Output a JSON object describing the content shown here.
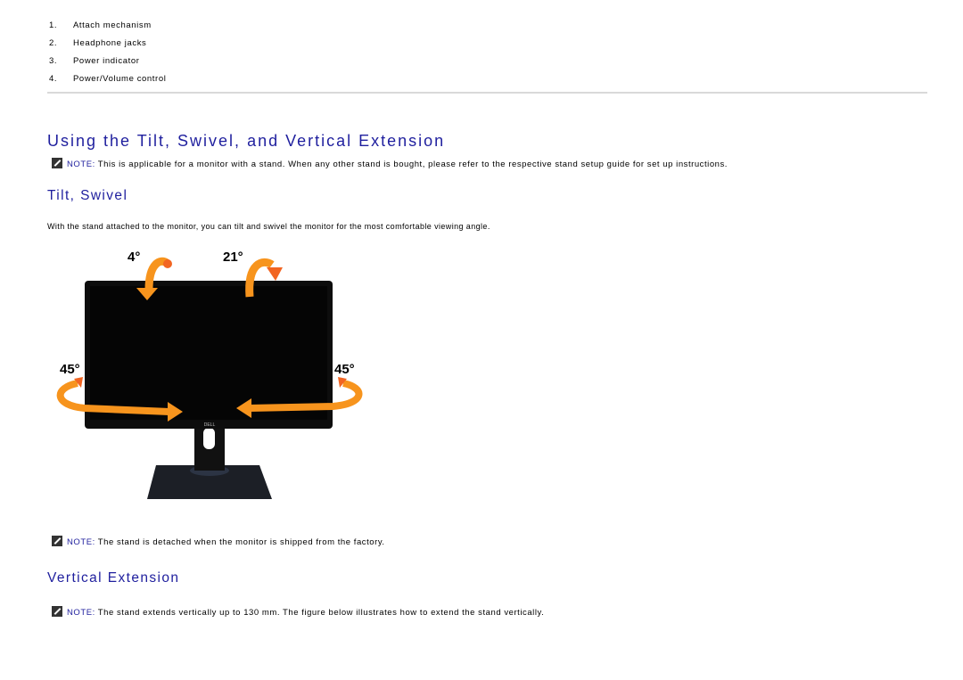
{
  "parts_list": [
    {
      "num": "1.",
      "label": "Attach mechanism"
    },
    {
      "num": "2.",
      "label": "Headphone jacks"
    },
    {
      "num": "3.",
      "label": "Power indicator"
    },
    {
      "num": "4.",
      "label": "Power/Volume control"
    }
  ],
  "section": {
    "title": "Using the Tilt, Swivel, and Vertical Extension",
    "note": {
      "label": "NOTE:",
      "text": " This is applicable for a monitor with a stand. When any other stand is bought, please refer to the respective stand setup guide for set up instructions."
    }
  },
  "tilt_swivel": {
    "title": "Tilt, Swivel",
    "intro": "With the stand attached to the monitor, you can tilt and swivel the monitor for the most comfortable viewing angle.",
    "figure": {
      "tilt_forward": "4°",
      "tilt_back": "21°",
      "swivel_left": "45°",
      "swivel_right": "45°",
      "brand": "DELL"
    },
    "note": {
      "label": "NOTE:",
      "text": " The stand is detached when the monitor is shipped from the factory."
    }
  },
  "vertical_extension": {
    "title": "Vertical Extension",
    "note": {
      "label": "NOTE:",
      "text": " The stand extends vertically up to 130 mm. The figure below illustrates how to extend the stand vertically."
    }
  },
  "colors": {
    "heading": "#1f1f9e",
    "arrow": "#f7941d",
    "arrow_tip": "#f26522",
    "rule": "#d9d9d9"
  }
}
